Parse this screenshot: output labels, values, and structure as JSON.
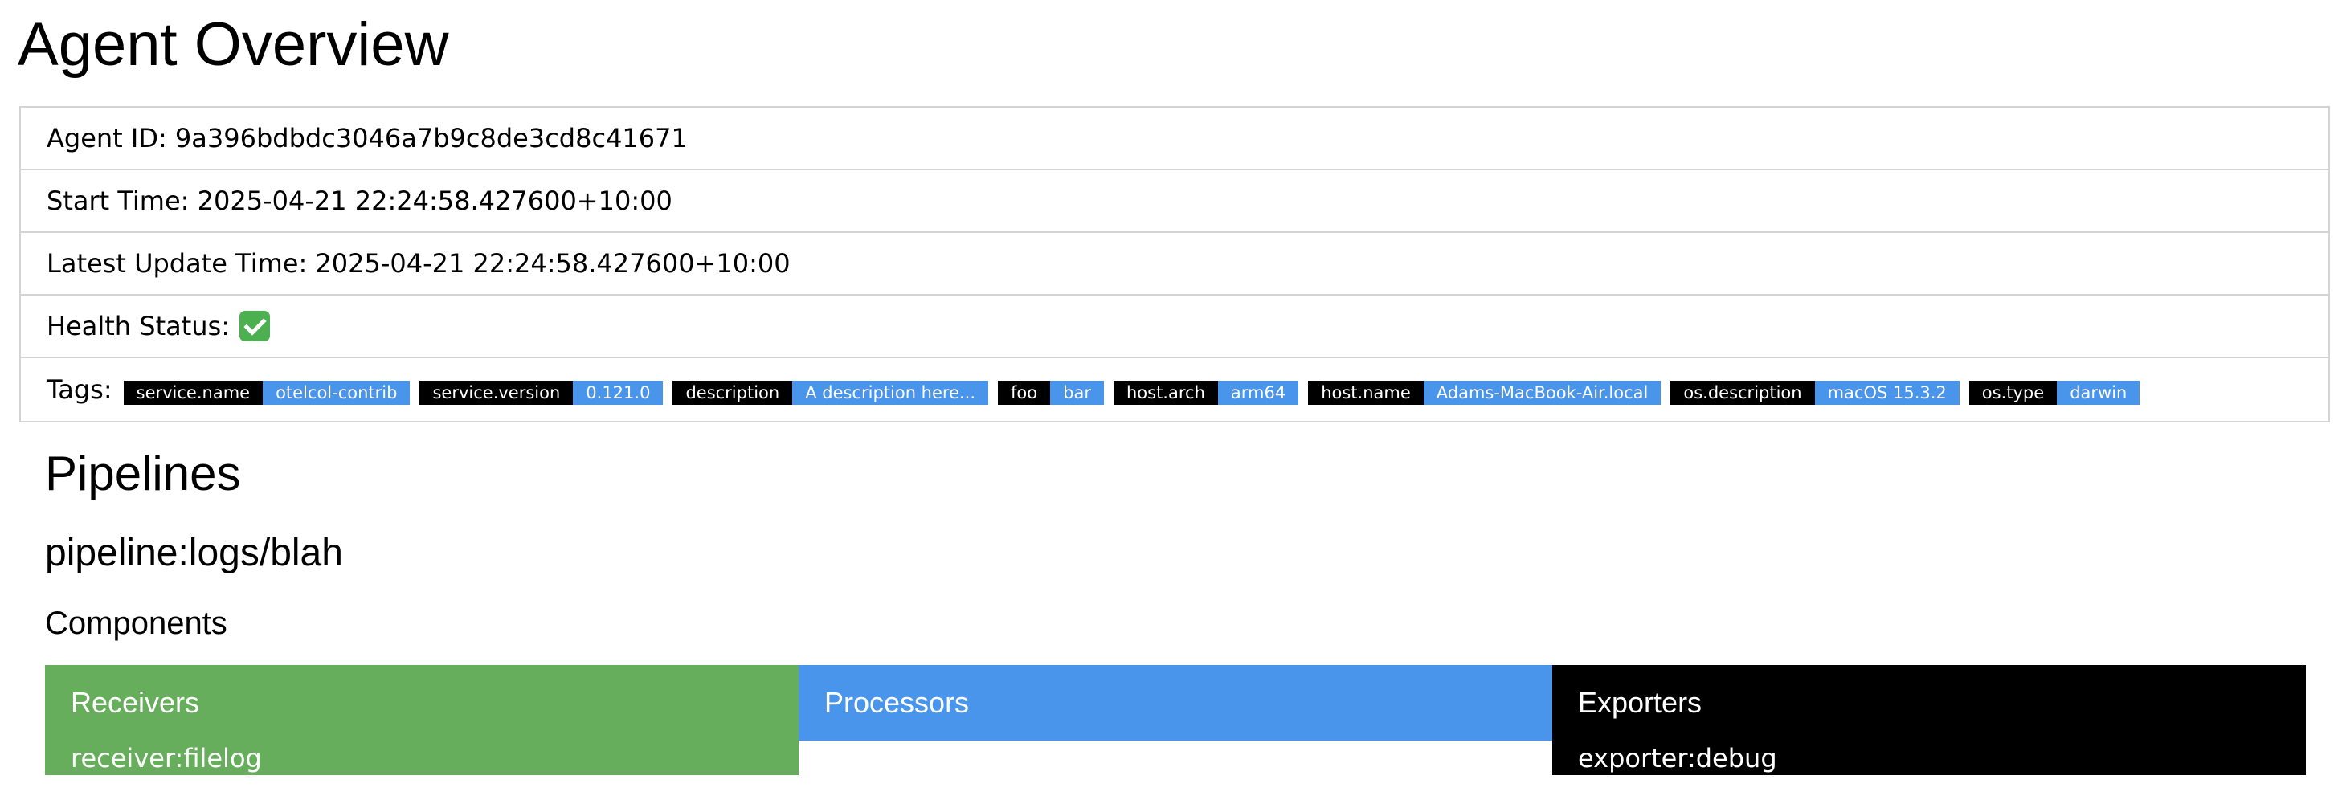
{
  "page": {
    "title": "Agent Overview"
  },
  "agent": {
    "id_label": "Agent ID: 9a396bdbdc3046a7b9c8de3cd8c41671",
    "start_time_label": "Start Time: 2025-04-21 22:24:58.427600+10:00",
    "latest_update_label": "Latest Update Time: 2025-04-21 22:24:58.427600+10:00",
    "health_label": "Health Status:",
    "health_icon": "check-mark-emoji-icon",
    "tags_label": "Tags:"
  },
  "tags": [
    {
      "key": "service.name",
      "value": "otelcol-contrib"
    },
    {
      "key": "service.version",
      "value": "0.121.0"
    },
    {
      "key": "description",
      "value": "A description here..."
    },
    {
      "key": "foo",
      "value": "bar"
    },
    {
      "key": "host.arch",
      "value": "arm64"
    },
    {
      "key": "host.name",
      "value": "Adams-MacBook-Air.local"
    },
    {
      "key": "os.description",
      "value": "macOS 15.3.2"
    },
    {
      "key": "os.type",
      "value": "darwin"
    }
  ],
  "pipelines": {
    "title": "Pipelines",
    "pipeline_name": "pipeline:logs/blah",
    "components_title": "Components",
    "receivers": {
      "title": "Receivers",
      "items": [
        "receiver:filelog"
      ]
    },
    "processors": {
      "title": "Processors",
      "items": []
    },
    "exporters": {
      "title": "Exporters",
      "items": [
        "exporter:debug"
      ]
    }
  },
  "colors": {
    "tag_key_bg": "#000000",
    "tag_value_bg": "#4a95ec",
    "receivers_bg": "#66ad5c",
    "processors_bg": "#4a95ec",
    "exporters_bg": "#000000",
    "health_ok": "#4caf50"
  }
}
